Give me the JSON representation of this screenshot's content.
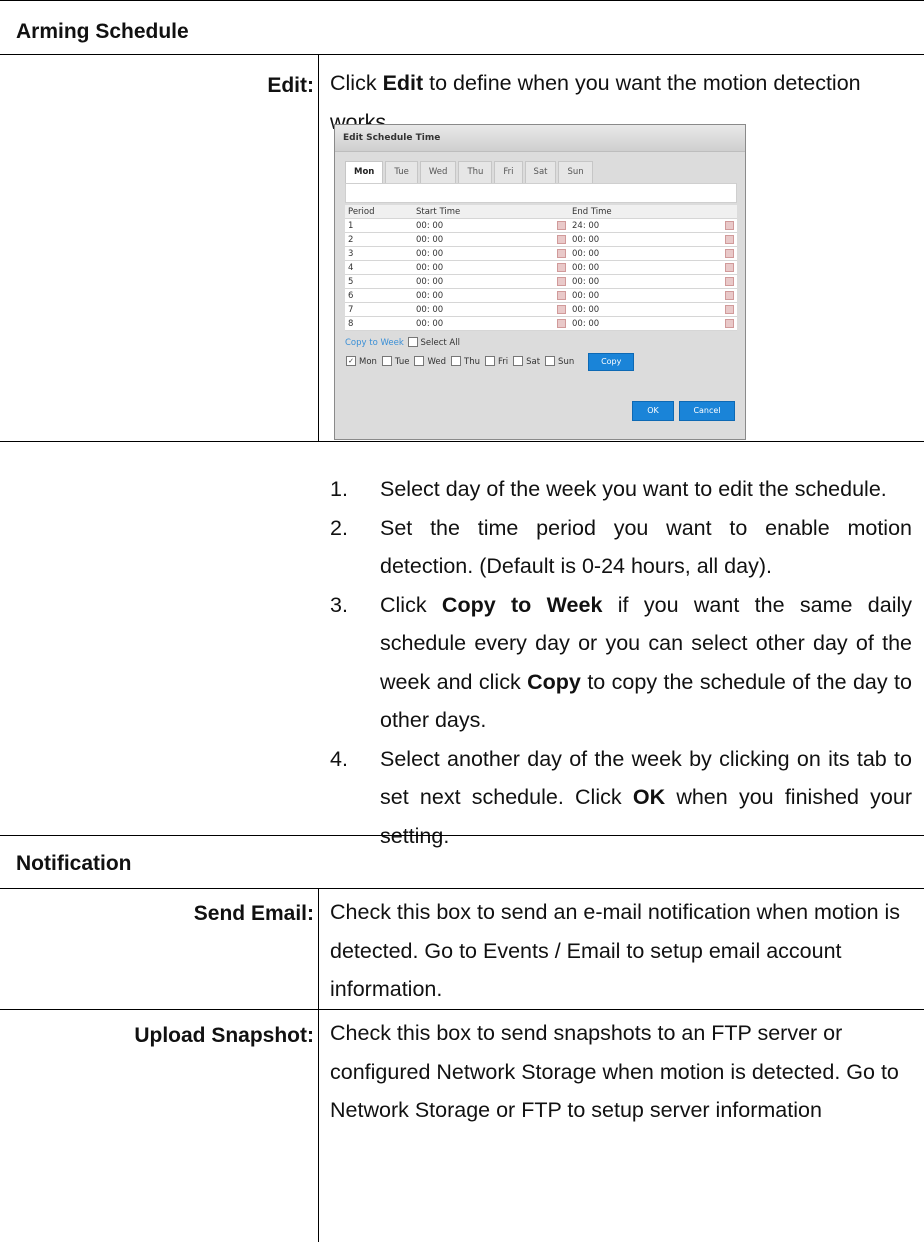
{
  "arming": {
    "heading": "Arming Schedule",
    "edit_label": "Edit:",
    "intro_pre": "Click ",
    "intro_bold": "Edit",
    "intro_post": " to define when you want the motion detection works.",
    "dialog": {
      "title": "Edit Schedule Time",
      "tabs": [
        "Mon",
        "Tue",
        "Wed",
        "Thu",
        "Fri",
        "Sat",
        "Sun"
      ],
      "active_tab": "Mon",
      "columns": [
        "Period",
        "Start Time",
        "End Time"
      ],
      "rows": [
        {
          "period": "1",
          "start": "00: 00",
          "end": "24: 00"
        },
        {
          "period": "2",
          "start": "00: 00",
          "end": "00: 00"
        },
        {
          "period": "3",
          "start": "00: 00",
          "end": "00: 00"
        },
        {
          "period": "4",
          "start": "00: 00",
          "end": "00: 00"
        },
        {
          "period": "5",
          "start": "00: 00",
          "end": "00: 00"
        },
        {
          "period": "6",
          "start": "00: 00",
          "end": "00: 00"
        },
        {
          "period": "7",
          "start": "00: 00",
          "end": "00: 00"
        },
        {
          "period": "8",
          "start": "00: 00",
          "end": "00: 00"
        }
      ],
      "copy_to_week": "Copy to Week",
      "select_all": "Select All",
      "days": [
        {
          "label": "Mon",
          "checked": true
        },
        {
          "label": "Tue",
          "checked": false
        },
        {
          "label": "Wed",
          "checked": false
        },
        {
          "label": "Thu",
          "checked": false
        },
        {
          "label": "Fri",
          "checked": false
        },
        {
          "label": "Sat",
          "checked": false
        },
        {
          "label": "Sun",
          "checked": false
        }
      ],
      "copy_button": "Copy",
      "ok_button": "OK",
      "cancel_button": "Cancel"
    },
    "steps": [
      {
        "num": "1.",
        "parts": [
          {
            "t": "Select day of the week you want to edit the schedule."
          }
        ]
      },
      {
        "num": "2.",
        "parts": [
          {
            "t": "Set the time period you want to enable motion detection. (Default is 0-24 hours, all day)."
          }
        ]
      },
      {
        "num": "3.",
        "parts": [
          {
            "t": "Click "
          },
          {
            "t": "Copy to Week",
            "b": true
          },
          {
            "t": " if you want the same daily schedule every day or you can select other day of the week and click "
          },
          {
            "t": "Copy",
            "b": true
          },
          {
            "t": " to copy the schedule of the day to other days."
          }
        ]
      },
      {
        "num": "4.",
        "parts": [
          {
            "t": "Select another day of the week by clicking on its tab to set next schedule. Click "
          },
          {
            "t": "OK",
            "b": true
          },
          {
            "t": " when you finished your setting."
          }
        ]
      }
    ]
  },
  "notification": {
    "heading": "Notification",
    "send_email_label": "Send Email:",
    "send_email_desc": "Check this box to send an e-mail notification when motion is detected. Go to Events / Email to setup email account information.",
    "upload_label": "Upload Snapshot:",
    "upload_desc": "Check this box to send snapshots to an FTP server or configured Network Storage when motion is detected. Go to Network Storage or FTP to setup server information"
  }
}
